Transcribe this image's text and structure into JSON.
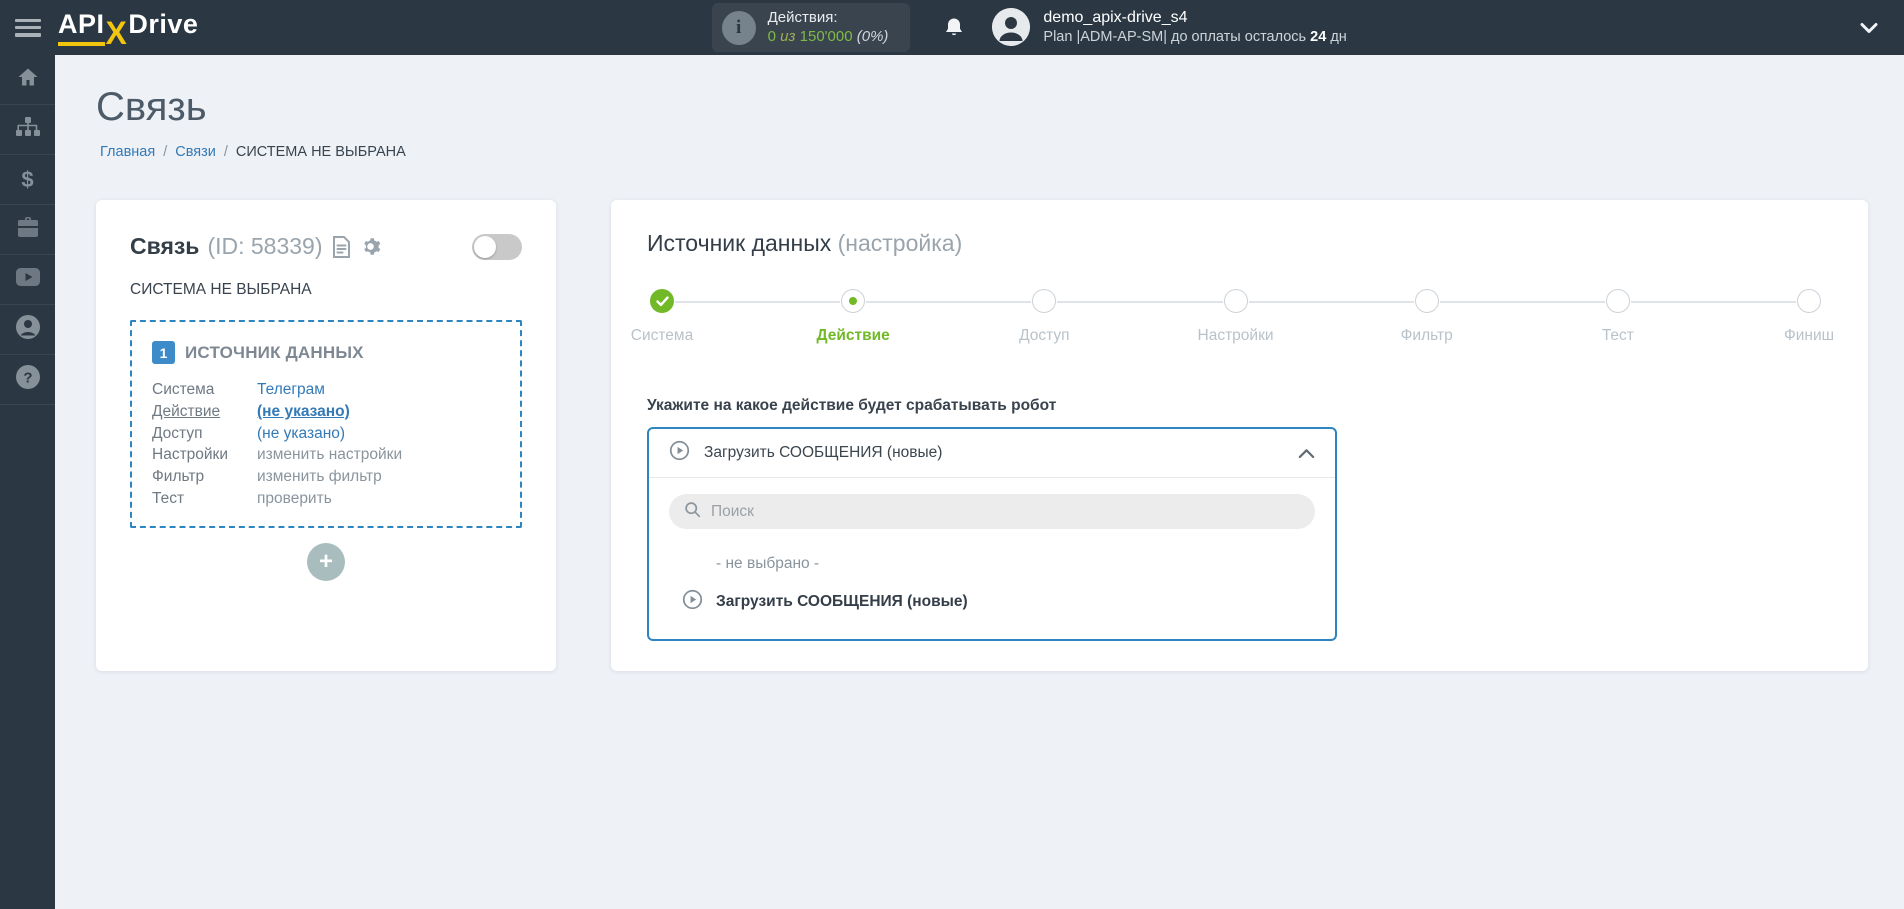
{
  "colors": {
    "header_bg": "#2b3844",
    "page_bg": "#eef1f6",
    "accent_blue": "#2e86c1",
    "link_blue": "#337ab7",
    "green": "#72b928",
    "counter_green": "#7fbb45",
    "logo_yellow": "#f2c50f"
  },
  "header": {
    "logo": {
      "part1": "API",
      "part2": "X",
      "part3": "Drive"
    },
    "actions": {
      "label": "Действия:",
      "used": "0",
      "of_word": "из",
      "total": "150'000",
      "percent": "(0%)"
    },
    "user": {
      "name": "demo_apix-drive_s4",
      "plan_prefix": "Plan |ADM-AP-SM| до оплаты осталось",
      "days": "24",
      "days_suffix": "дн"
    }
  },
  "sidebar": {
    "items": [
      {
        "name": "home"
      },
      {
        "name": "connections"
      },
      {
        "name": "billing"
      },
      {
        "name": "services"
      },
      {
        "name": "video"
      },
      {
        "name": "account"
      },
      {
        "name": "help"
      }
    ],
    "dollar_glyph": "$",
    "help_glyph": "?"
  },
  "page": {
    "title": "Связь",
    "breadcrumb": {
      "home": "Главная",
      "links": "Связи",
      "current": "СИСТЕМА НЕ ВЫБРАНА",
      "separator": "/"
    }
  },
  "left_card": {
    "title": "Связь",
    "id_text": "(ID: 58339)",
    "subtitle": "СИСТЕМА НЕ ВЫБРАНА",
    "box": {
      "badge": "1",
      "heading": "ИСТОЧНИК ДАННЫХ",
      "rows": [
        {
          "label": "Система",
          "value": "Телеграм"
        },
        {
          "label": "Действие",
          "value": "(не указано)"
        },
        {
          "label": "Доступ",
          "value": "(не указано)"
        },
        {
          "label": "Настройки",
          "value": "изменить настройки"
        },
        {
          "label": "Фильтр",
          "value": "изменить фильтр"
        },
        {
          "label": "Тест",
          "value": "проверить"
        }
      ]
    },
    "add_button": "+"
  },
  "right_card": {
    "title": "Источник данных",
    "title_suffix": "(настройка)",
    "steps": [
      {
        "label": "Система",
        "state": "done"
      },
      {
        "label": "Действие",
        "state": "active"
      },
      {
        "label": "Доступ",
        "state": "pending"
      },
      {
        "label": "Настройки",
        "state": "pending"
      },
      {
        "label": "Фильтр",
        "state": "pending"
      },
      {
        "label": "Тест",
        "state": "pending"
      },
      {
        "label": "Финиш",
        "state": "pending"
      }
    ],
    "form_label": "Укажите на какое действие будет срабатывать робот",
    "select": {
      "value": "Загрузить СООБЩЕНИЯ (новые)"
    },
    "dropdown": {
      "search_placeholder": "Поиск",
      "option_none": "- не выбрано -",
      "option_main": "Загрузить СООБЩЕНИЯ (новые)"
    }
  }
}
